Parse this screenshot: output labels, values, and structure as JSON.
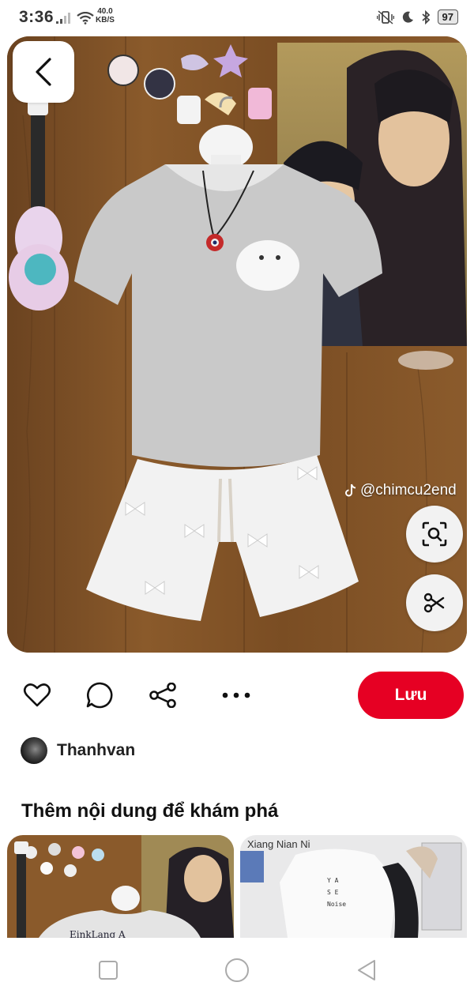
{
  "status_bar": {
    "time": "3:36",
    "speed_value": "40.0",
    "speed_unit": "KB/S",
    "battery": "97"
  },
  "pin": {
    "watermark": "@chimcu2end",
    "back_icon": "chevron-left-icon",
    "visual_search_icon": "lens-scan-icon",
    "cut_icon": "scissors-icon"
  },
  "actions": {
    "like_icon": "heart-icon",
    "comment_icon": "speech-bubble-icon",
    "share_icon": "share-icon",
    "more_icon": "more-dots-icon",
    "save_label": "Lưu",
    "save_color": "#e60023"
  },
  "author": {
    "name": "Thanhvan"
  },
  "more_section": {
    "title": "Thêm nội dung để khám phá",
    "items": [
      {
        "caption": "EinkLang A"
      },
      {
        "caption": "Xiang Nian Ni"
      }
    ]
  },
  "navbar": {
    "icons": [
      "recents-square-icon",
      "home-circle-icon",
      "back-triangle-icon"
    ]
  }
}
